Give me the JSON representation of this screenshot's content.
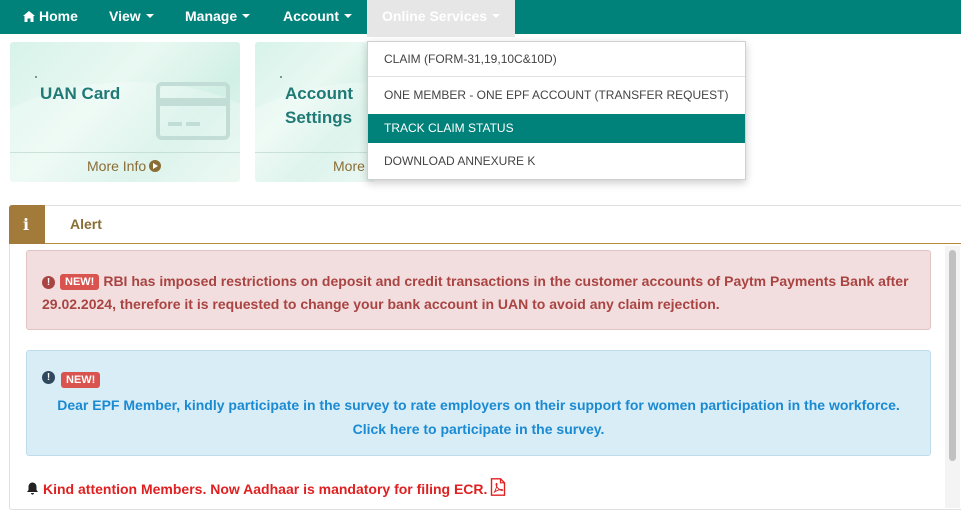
{
  "navbar": {
    "home": "Home",
    "view": "View",
    "manage": "Manage",
    "account": "Account",
    "online_services": "Online Services"
  },
  "cards": {
    "uan": {
      "title": "UAN Card",
      "link": "More Info"
    },
    "account_settings": {
      "title": "Account Settings",
      "link": "More"
    }
  },
  "dropdown": {
    "items": [
      "CLAIM (FORM-31,19,10C&10D)",
      "ONE MEMBER - ONE EPF ACCOUNT (TRANSFER REQUEST)",
      "TRACK CLAIM STATUS",
      "DOWNLOAD ANNEXURE K"
    ],
    "active_item": "TRACK CLAIM STATUS"
  },
  "alert_panel": {
    "title": "Alert",
    "badge": "NEW!",
    "red_alert": "RBI has imposed restrictions on deposit and credit transactions in the customer accounts of Paytm Payments Bank after 29.02.2024, therefore it is requested to change your bank account in UAN to avoid any claim rejection.",
    "blue_alert": {
      "line1": "Dear EPF Member, kindly participate in the survey to rate employers on their support for women participation in the workforce.",
      "line2": "Click here to participate in the survey."
    },
    "notice": "Kind attention Members. Now Aadhaar is mandatory for filing ECR."
  },
  "colors": {
    "nav_bg": "#00817a",
    "active_menu_bg": "#00817a",
    "alert_red_text": "#a94442",
    "alert_blue_text": "#1a8ad2",
    "notice_red": "#e02020",
    "accent_brown": "#a27b3a"
  }
}
